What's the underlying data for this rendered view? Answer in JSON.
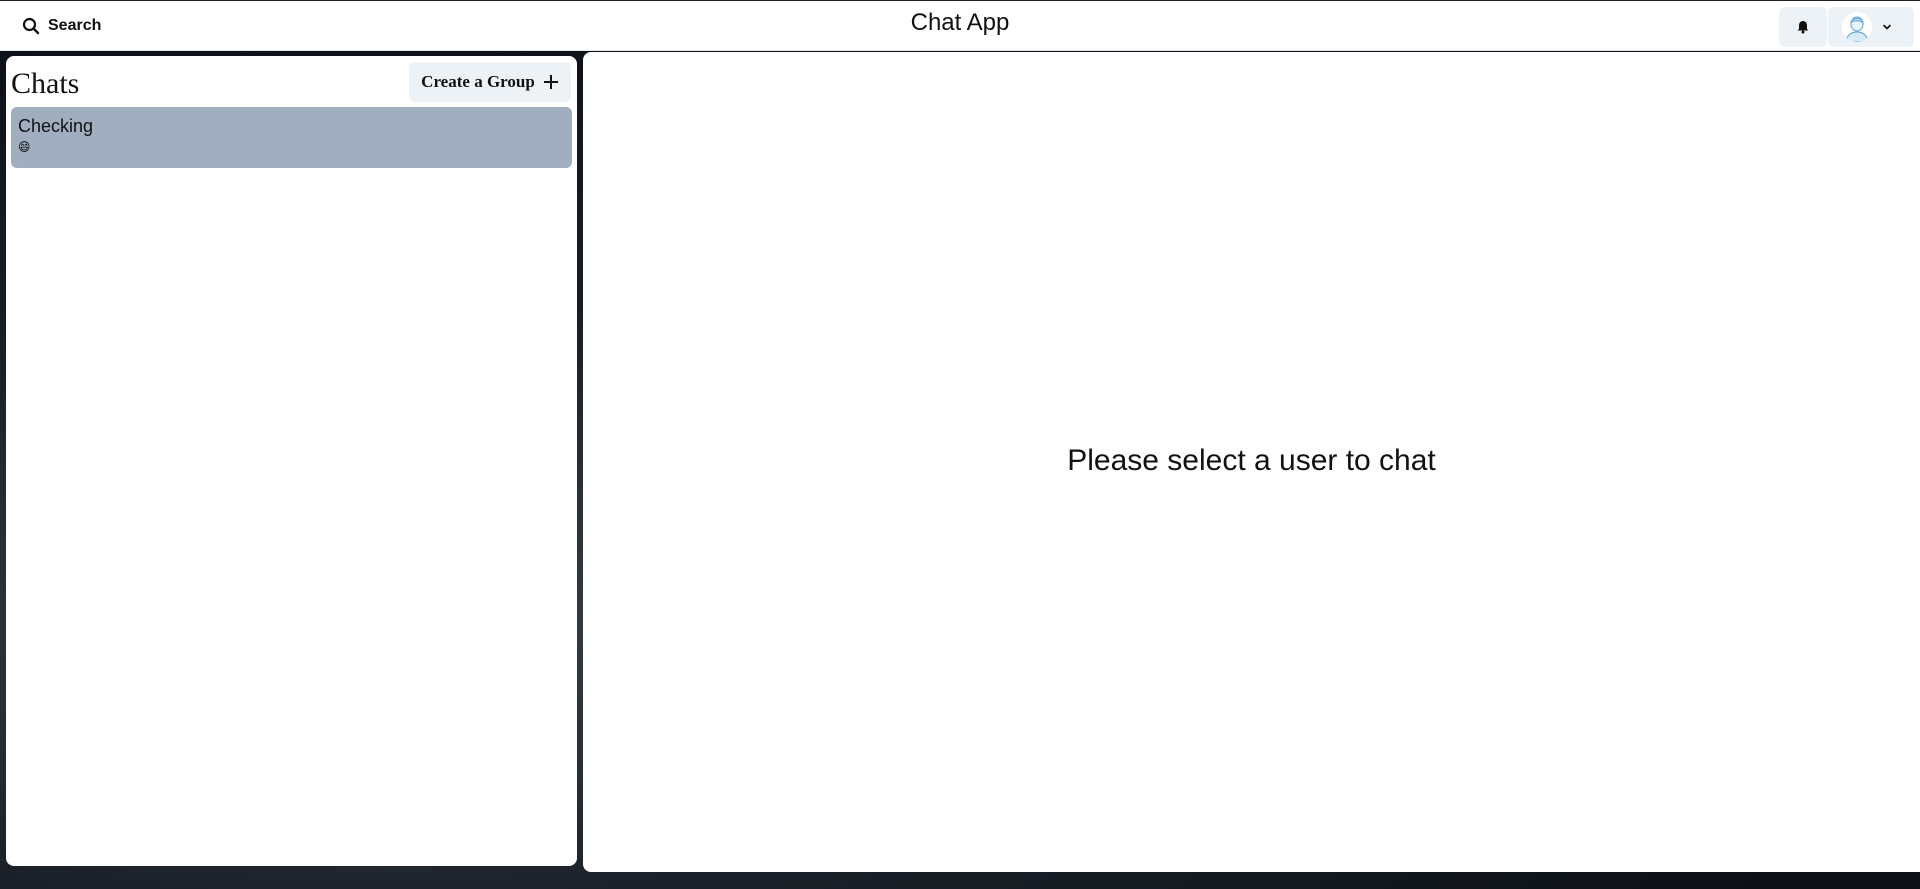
{
  "header": {
    "search_label": "Search",
    "title": "Chat App",
    "icons": {
      "search": "search-icon",
      "notification": "bell-icon",
      "profile": "user-avatar",
      "menu": "chevron-down-icon"
    }
  },
  "sidebar": {
    "title": "Chats",
    "create_group_label": "Create a Group",
    "chats": [
      {
        "name": "Checking",
        "preview": "😄"
      }
    ]
  },
  "main": {
    "empty_message": "Please select a user to chat"
  },
  "colors": {
    "selected_chat": "#a0aec0",
    "button_bg": "#edf2f7",
    "panel_bg": "#ffffff"
  }
}
